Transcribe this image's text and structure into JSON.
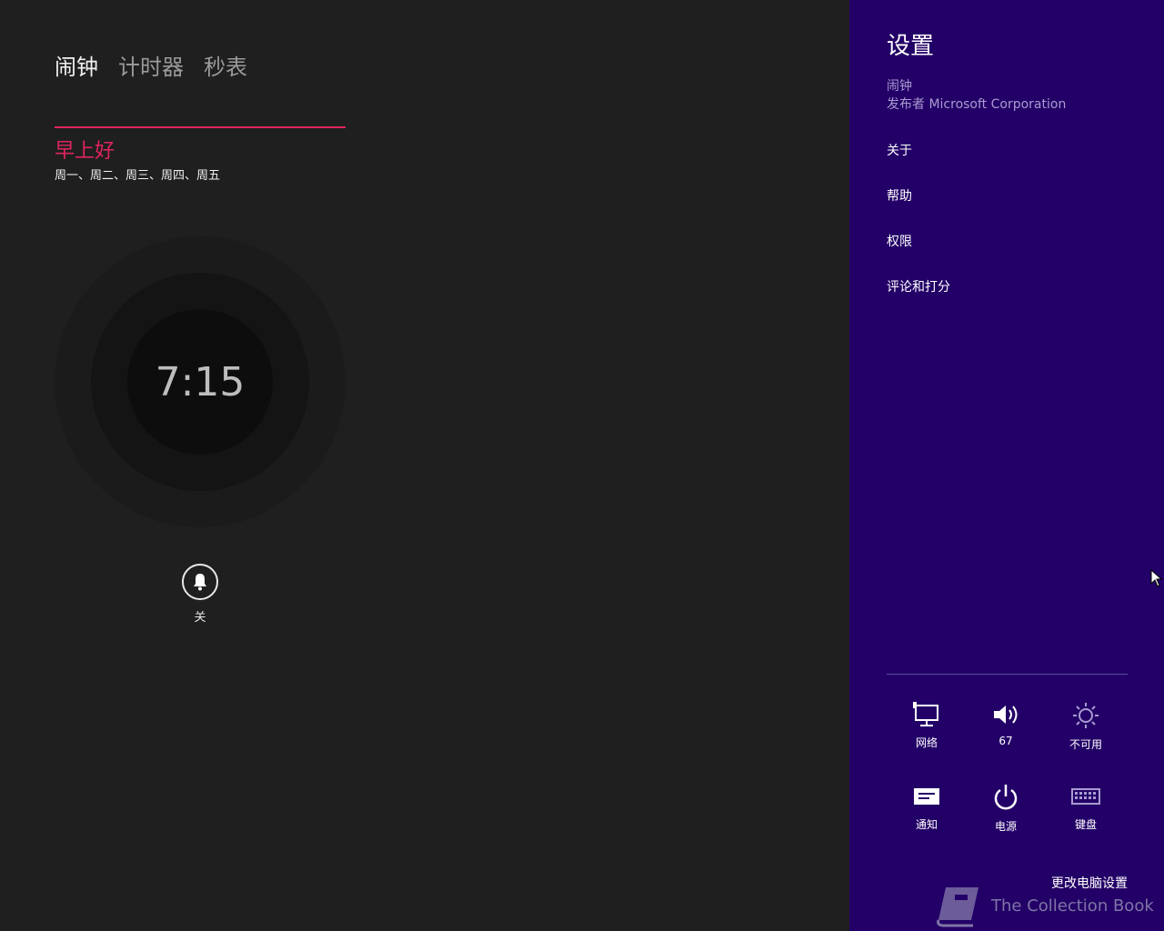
{
  "tabs": [
    {
      "label": "闹钟",
      "active": true
    },
    {
      "label": "计时器",
      "active": false
    },
    {
      "label": "秒表",
      "active": false
    }
  ],
  "alarm": {
    "name": "早上好",
    "days": "周一、周二、周三、周四、周五",
    "time": "7:15",
    "toggle_label": "关",
    "accent": "#e0245e"
  },
  "settings": {
    "title": "设置",
    "app_name": "闹钟",
    "publisher": "发布者 Microsoft Corporation",
    "menu": [
      "关于",
      "帮助",
      "权限",
      "评论和打分"
    ],
    "background": "#230067",
    "quick": [
      {
        "icon": "network-icon",
        "label": "网络"
      },
      {
        "icon": "volume-icon",
        "label": "67"
      },
      {
        "icon": "brightness-icon",
        "label": "不可用"
      },
      {
        "icon": "notifications-icon",
        "label": "通知"
      },
      {
        "icon": "power-icon",
        "label": "电源"
      },
      {
        "icon": "keyboard-icon",
        "label": "键盘"
      }
    ],
    "change_pc_settings": "更改电脑设置"
  },
  "watermark": "The Collection Book"
}
